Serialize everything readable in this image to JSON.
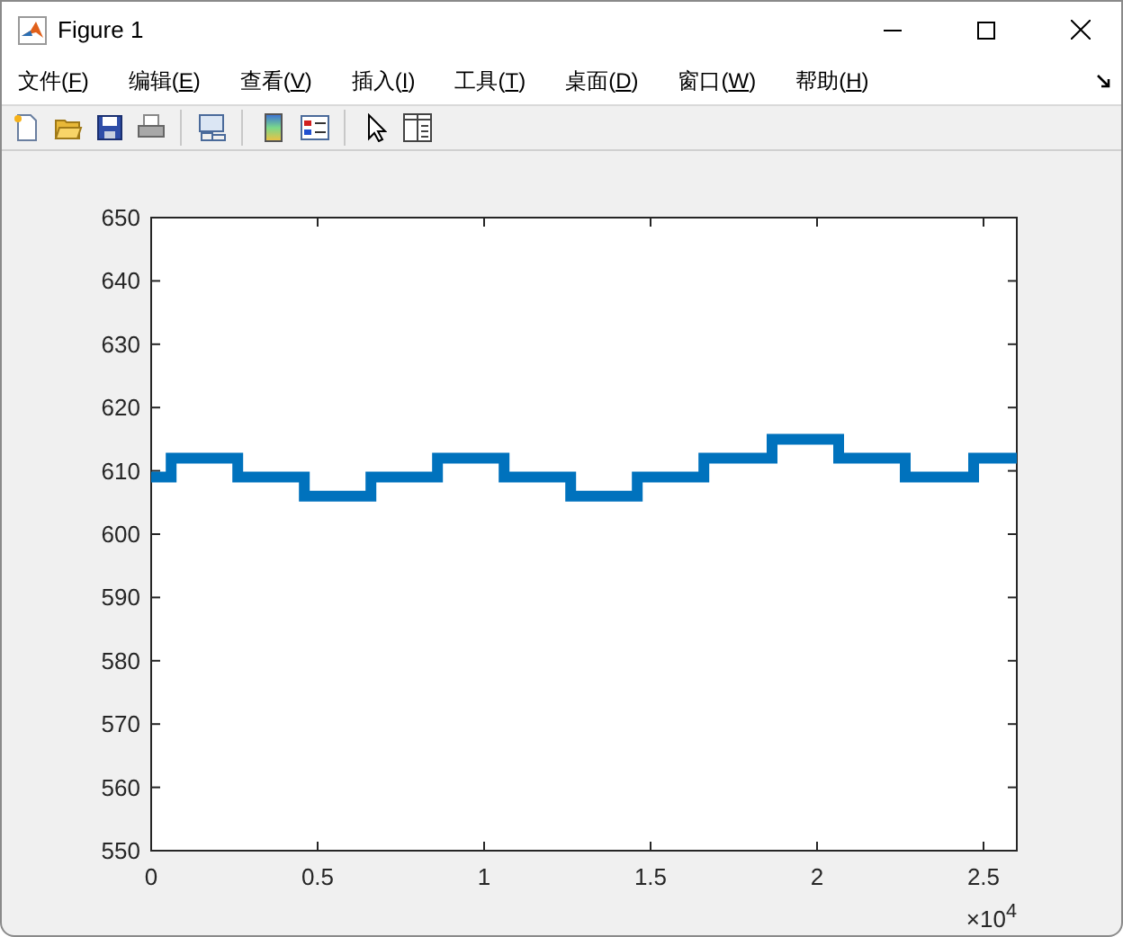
{
  "window": {
    "title": "Figure 1"
  },
  "menu": [
    "文件(F)",
    "编辑(E)",
    "查看(V)",
    "插入(I)",
    "工具(T)",
    "桌面(D)",
    "窗口(W)",
    "帮助(H)"
  ],
  "figure": {
    "axis_multiplier": "×10$^{4}$",
    "chart_data": {
      "type": "line",
      "x": [
        0,
        0.06,
        0.06,
        0.26,
        0.26,
        0.46,
        0.46,
        0.66,
        0.66,
        0.86,
        0.86,
        1.06,
        1.06,
        1.26,
        1.26,
        1.46,
        1.46,
        1.66,
        1.66,
        1.865,
        1.865,
        2.065,
        2.065,
        2.265,
        2.265,
        2.47,
        2.47,
        2.6
      ],
      "series": [
        {
          "color": "#0072bd",
          "values": [
            609,
            609,
            612,
            612,
            609,
            609,
            606,
            606,
            609,
            609,
            612,
            612,
            609,
            609,
            606,
            606,
            609,
            609,
            612,
            612,
            615,
            615,
            612,
            612,
            609,
            609,
            612,
            612
          ]
        }
      ],
      "xlim": [
        0,
        2.6
      ],
      "ylim": [
        550,
        650
      ],
      "xticks": [
        0,
        0.5,
        1,
        1.5,
        2,
        2.5
      ],
      "yticks": [
        550,
        560,
        570,
        580,
        590,
        600,
        610,
        620,
        630,
        640,
        650
      ]
    }
  }
}
